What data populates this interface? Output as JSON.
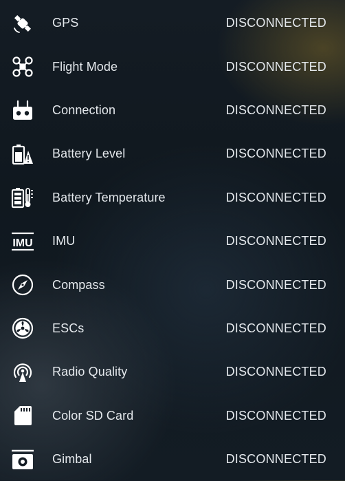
{
  "items": [
    {
      "label": "GPS",
      "status": "DISCONNECTED",
      "icon": "satellite-icon"
    },
    {
      "label": "Flight Mode",
      "status": "DISCONNECTED",
      "icon": "drone-icon"
    },
    {
      "label": "Connection",
      "status": "DISCONNECTED",
      "icon": "remote-controller-icon"
    },
    {
      "label": "Battery Level",
      "status": "DISCONNECTED",
      "icon": "battery-level-icon"
    },
    {
      "label": "Battery Temperature",
      "status": "DISCONNECTED",
      "icon": "battery-temperature-icon"
    },
    {
      "label": "IMU",
      "status": "DISCONNECTED",
      "icon": "imu-icon"
    },
    {
      "label": "Compass",
      "status": "DISCONNECTED",
      "icon": "compass-icon"
    },
    {
      "label": "ESCs",
      "status": "DISCONNECTED",
      "icon": "esc-icon"
    },
    {
      "label": "Radio Quality",
      "status": "DISCONNECTED",
      "icon": "radio-quality-icon"
    },
    {
      "label": "Color SD Card",
      "status": "DISCONNECTED",
      "icon": "sd-card-icon"
    },
    {
      "label": "Gimbal",
      "status": "DISCONNECTED",
      "icon": "gimbal-camera-icon"
    }
  ],
  "imu_icon_text": "IMU",
  "colors": {
    "text": "#e4e8ec",
    "background": "#131b23"
  }
}
